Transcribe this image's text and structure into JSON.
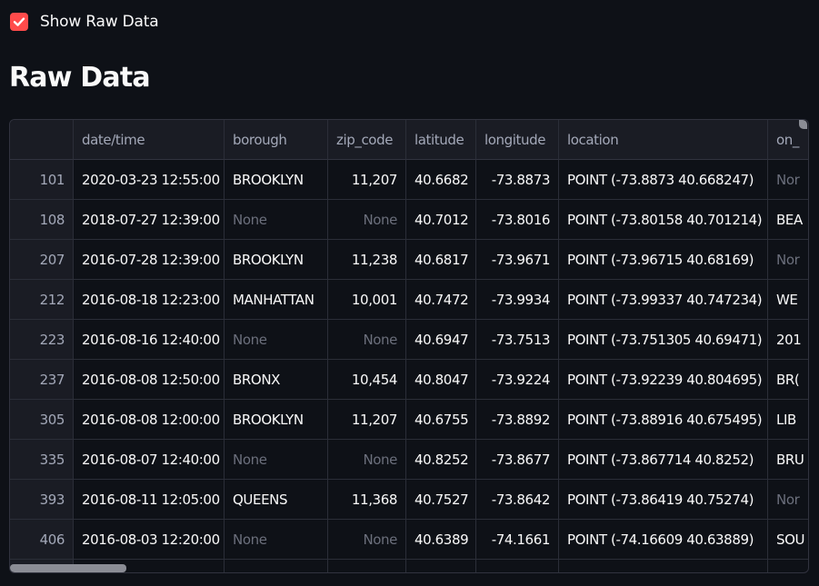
{
  "show_raw": {
    "label": "Show Raw Data",
    "checked": true,
    "accent": "#ff4b4b"
  },
  "title": "Raw Data",
  "table": {
    "columns": [
      "",
      "date/time",
      "borough",
      "zip_code",
      "latitude",
      "longitude",
      "location",
      "on_"
    ],
    "rows": [
      {
        "idx": "101",
        "datetime": "2020-03-23 12:55:00",
        "borough": "BROOKLYN",
        "zip": "11,207",
        "lat": "40.6682",
        "lon": "-73.8873",
        "loc": "POINT (-73.8873 40.668247)",
        "on": "Nor"
      },
      {
        "idx": "108",
        "datetime": "2018-07-27 12:39:00",
        "borough": "None",
        "zip": "None",
        "lat": "40.7012",
        "lon": "-73.8016",
        "loc": "POINT (-73.80158 40.701214)",
        "on": "BEA"
      },
      {
        "idx": "207",
        "datetime": "2016-07-28 12:39:00",
        "borough": "BROOKLYN",
        "zip": "11,238",
        "lat": "40.6817",
        "lon": "-73.9671",
        "loc": "POINT (-73.96715 40.68169)",
        "on": "Nor"
      },
      {
        "idx": "212",
        "datetime": "2016-08-18 12:23:00",
        "borough": "MANHATTAN",
        "zip": "10,001",
        "lat": "40.7472",
        "lon": "-73.9934",
        "loc": "POINT (-73.99337 40.747234)",
        "on": "WE"
      },
      {
        "idx": "223",
        "datetime": "2016-08-16 12:40:00",
        "borough": "None",
        "zip": "None",
        "lat": "40.6947",
        "lon": "-73.7513",
        "loc": "POINT (-73.751305 40.69471)",
        "on": "201"
      },
      {
        "idx": "237",
        "datetime": "2016-08-08 12:50:00",
        "borough": "BRONX",
        "zip": "10,454",
        "lat": "40.8047",
        "lon": "-73.9224",
        "loc": "POINT (-73.92239 40.804695)",
        "on": "BR("
      },
      {
        "idx": "305",
        "datetime": "2016-08-08 12:00:00",
        "borough": "BROOKLYN",
        "zip": "11,207",
        "lat": "40.6755",
        "lon": "-73.8892",
        "loc": "POINT (-73.88916 40.675495)",
        "on": "LIB"
      },
      {
        "idx": "335",
        "datetime": "2016-08-07 12:40:00",
        "borough": "None",
        "zip": "None",
        "lat": "40.8252",
        "lon": "-73.8677",
        "loc": "POINT (-73.867714 40.8252)",
        "on": "BRU"
      },
      {
        "idx": "393",
        "datetime": "2016-08-11 12:05:00",
        "borough": "QUEENS",
        "zip": "11,368",
        "lat": "40.7527",
        "lon": "-73.8642",
        "loc": "POINT (-73.86419 40.75274)",
        "on": "Nor"
      },
      {
        "idx": "406",
        "datetime": "2016-08-03 12:20:00",
        "borough": "None",
        "zip": "None",
        "lat": "40.6389",
        "lon": "-74.1661",
        "loc": "POINT (-74.16609 40.63889)",
        "on": "SOU"
      },
      {
        "idx": "",
        "datetime": "",
        "borough": "",
        "zip": "",
        "lat": "",
        "lon": "",
        "loc": "",
        "on": ""
      }
    ]
  },
  "colors": {
    "background": "#0e1117",
    "header_bg": "#1a1c24",
    "none_text": "#6b6f7c"
  }
}
